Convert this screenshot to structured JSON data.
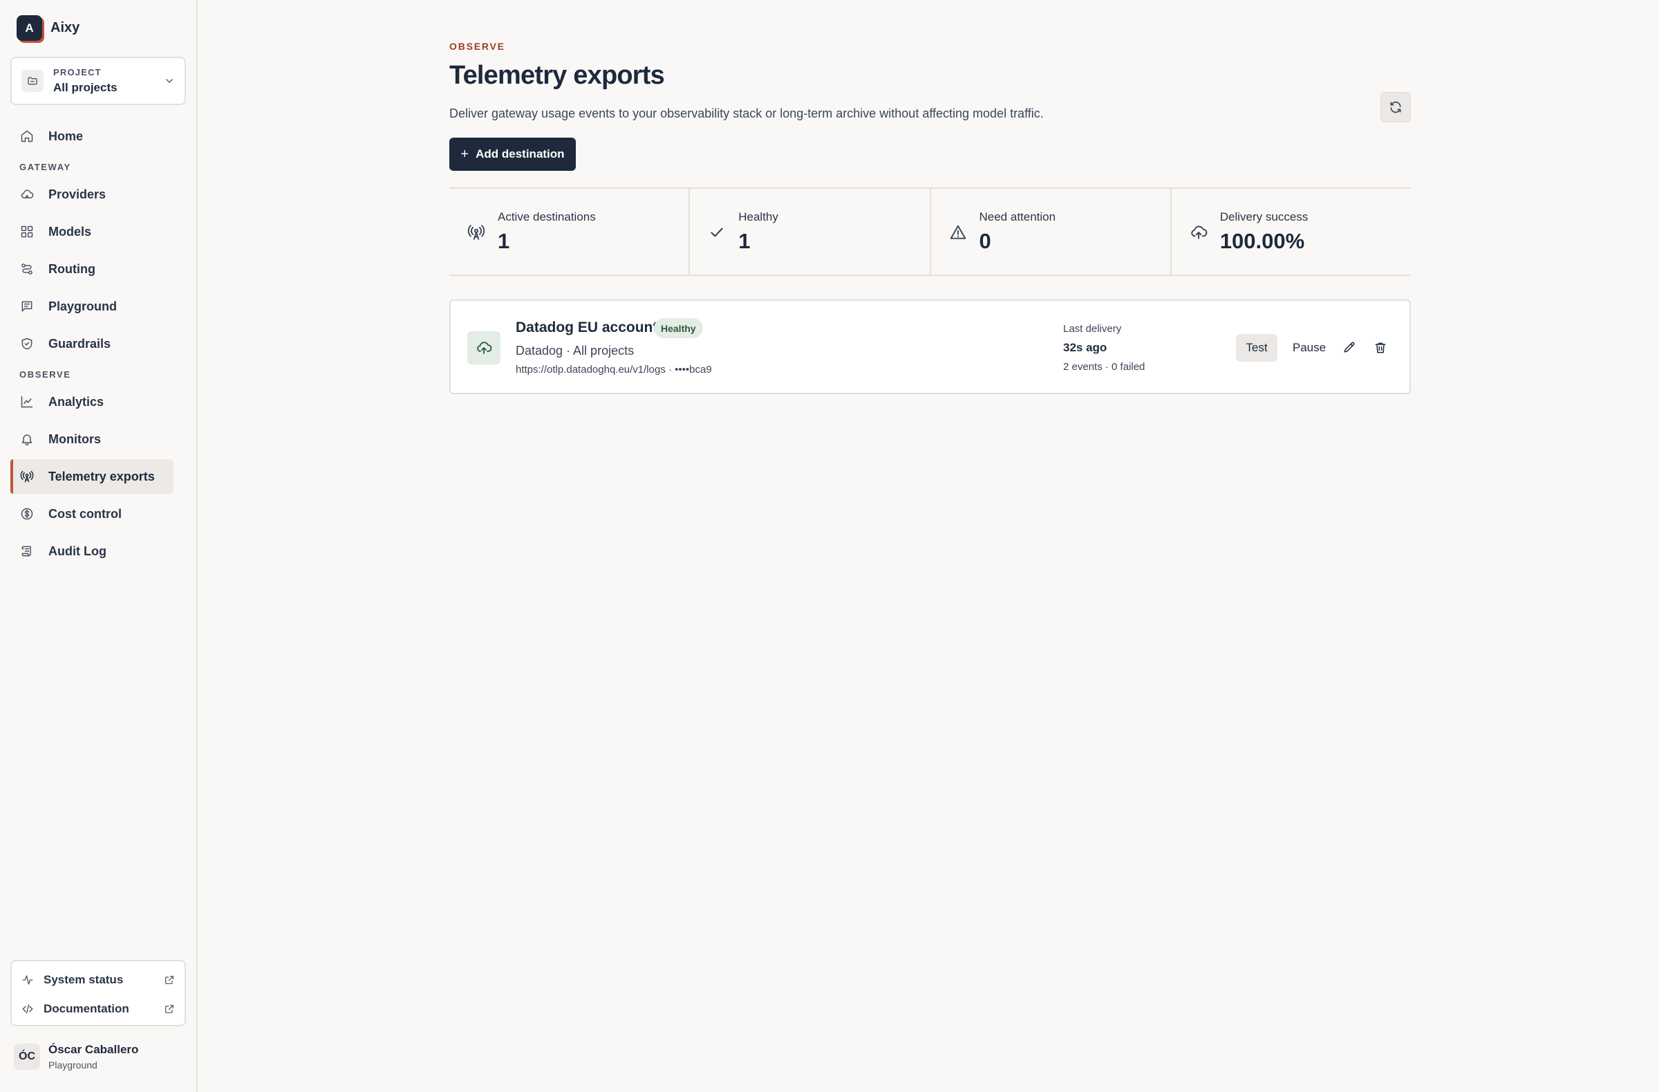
{
  "brand": {
    "logo_letter": "A",
    "name": "Aixy"
  },
  "project": {
    "kicker": "PROJECT",
    "value": "All projects"
  },
  "nav": {
    "home": "Home",
    "section_gateway": "GATEWAY",
    "providers": "Providers",
    "models": "Models",
    "routing": "Routing",
    "playground": "Playground",
    "guardrails": "Guardrails",
    "section_observe": "OBSERVE",
    "analytics": "Analytics",
    "monitors": "Monitors",
    "telemetry_exports": "Telemetry exports",
    "cost_control": "Cost control",
    "audit_log": "Audit Log",
    "active_item": "Telemetry exports"
  },
  "footer_links": {
    "system_status": "System status",
    "documentation": "Documentation"
  },
  "user": {
    "initials": "ÓC",
    "name": "Óscar Caballero",
    "role": "Playground"
  },
  "page": {
    "kicker": "OBSERVE",
    "title": "Telemetry exports",
    "description": "Deliver gateway usage events to your observability stack or long-term archive without affecting model traffic.",
    "add_button": "Add destination"
  },
  "stats": [
    {
      "label": "Active destinations",
      "value": "1",
      "icon": "antenna-icon"
    },
    {
      "label": "Healthy",
      "value": "1",
      "icon": "check-icon"
    },
    {
      "label": "Need attention",
      "value": "0",
      "icon": "warning-icon"
    },
    {
      "label": "Delivery success",
      "value": "100.00%",
      "icon": "cloud-upload-icon"
    }
  ],
  "destination": {
    "name": "Datadog EU account",
    "status": "Healthy",
    "subtitle": "Datadog · All projects",
    "endpoint": "https://otlp.datadoghq.eu/v1/logs · ••••bca9",
    "last_delivery_label": "Last delivery",
    "last_delivery_time": "32s ago",
    "delivery_stats": "2 events · 0 failed",
    "test_label": "Test",
    "pause_label": "Pause"
  },
  "colors": {
    "primary": "#1e2a3b",
    "accent": "#c0553a",
    "kicker": "#9a3d26",
    "healthy_bg": "#e3ede5",
    "healthy_text": "#2f5a3a",
    "background": "#f9f8f7"
  }
}
